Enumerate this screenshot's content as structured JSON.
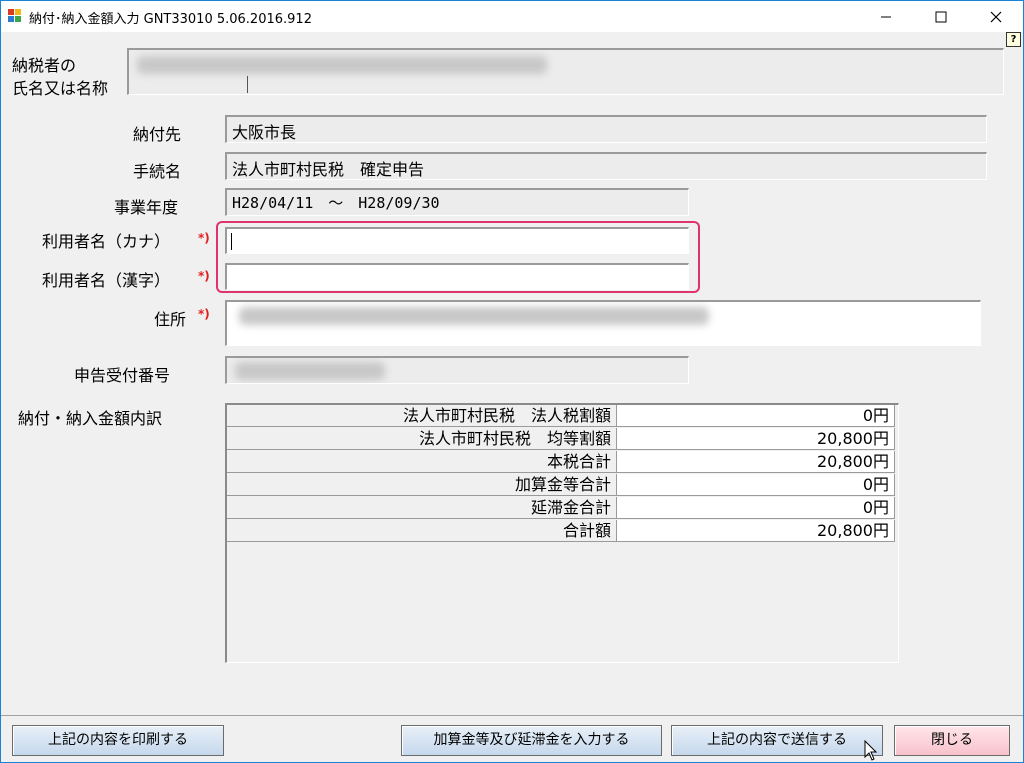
{
  "window": {
    "title": "納付･納入金額入力 GNT33010  5.06.2016.912",
    "controls": {
      "minimize_icon": "minimize-icon",
      "maximize_icon": "maximize-icon",
      "close_icon": "close-icon"
    },
    "help_glyph": "?"
  },
  "taxpayer": {
    "label_line1": "納税者の",
    "label_line2": "氏名又は名称"
  },
  "form": {
    "payee": {
      "label": "納付先",
      "value": "大阪市長"
    },
    "procedure": {
      "label": "手続名",
      "value": "法人市町村民税　確定申告"
    },
    "fiscal_year": {
      "label": "事業年度",
      "value": "H28/04/11　～　H28/09/30"
    },
    "user_kana": {
      "label": "利用者名（カナ）",
      "required_mark": "*)",
      "value": ""
    },
    "user_kanji": {
      "label": "利用者名（漢字）",
      "required_mark": "*)",
      "value": ""
    },
    "address": {
      "label": "住所",
      "required_mark": "*)"
    },
    "receipt_number": {
      "label": "申告受付番号"
    }
  },
  "breakdown": {
    "label": "納付・納入金額内訳",
    "rows": [
      {
        "name": "法人市町村民税　法人税割額",
        "amount": "0円"
      },
      {
        "name": "法人市町村民税　均等割額",
        "amount": "20,800円"
      },
      {
        "name": "本税合計",
        "amount": "20,800円"
      },
      {
        "name": "加算金等合計",
        "amount": "0円"
      },
      {
        "name": "延滞金合計",
        "amount": "0円"
      },
      {
        "name": "合計額",
        "amount": "20,800円"
      }
    ]
  },
  "buttons": {
    "print": "上記の内容を印刷する",
    "enter_penalty": "加算金等及び延滞金を入力する",
    "submit": "上記の内容で送信する",
    "close": "閉じる"
  },
  "colors": {
    "highlight": "#e0336b",
    "required": "#e02020",
    "titlebar_border": "#1883d7"
  }
}
